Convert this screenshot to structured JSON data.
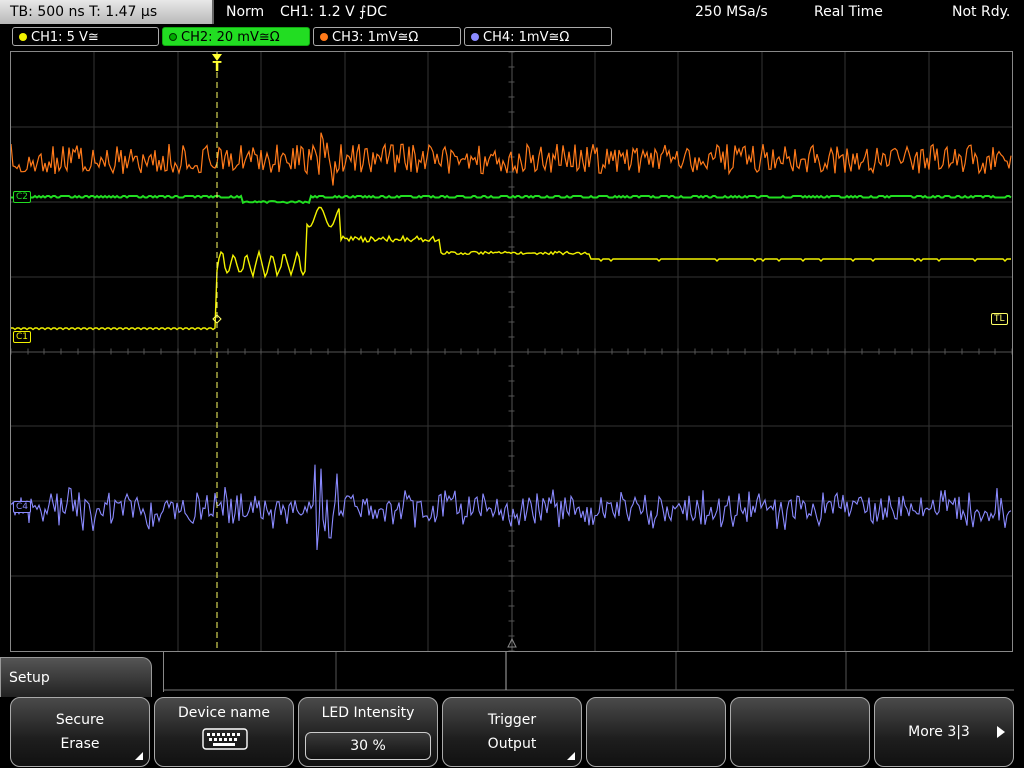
{
  "topbar": {
    "timebase": "TB: 500 ns   T: 1.47 µs",
    "mode": "Norm",
    "trigger": "CH1: 1.2 V ⨍DC",
    "sample_rate": "250 MSa/s",
    "acq_mode": "Real Time",
    "status": "Not Rdy."
  },
  "channels": [
    {
      "label": "CH1: 5 V≅",
      "color": "#f2f200"
    },
    {
      "label": "CH2: 20 mV≅Ω",
      "color": "#22dd22"
    },
    {
      "label": "CH3: 1mV≅Ω",
      "color": "#ff7a1a"
    },
    {
      "label": "CH4: 1mV≅Ω",
      "color": "#8a8aff"
    }
  ],
  "markers": {
    "trigger_pos": "T",
    "trigger_level": "TL",
    "c1": "C1",
    "c2": "C2",
    "c4": "C4"
  },
  "setup_tab": "Setup",
  "softkeys": [
    {
      "l1": "Secure",
      "l2": "Erase"
    },
    {
      "l1": "Device name",
      "icon": "keyboard-icon"
    },
    {
      "l1": "LED Intensity",
      "value": "30 %"
    },
    {
      "l1": "Trigger",
      "l2": "Output"
    },
    {
      "l1": ""
    },
    {
      "l1": ""
    },
    {
      "l1": "More 3|3"
    }
  ]
}
